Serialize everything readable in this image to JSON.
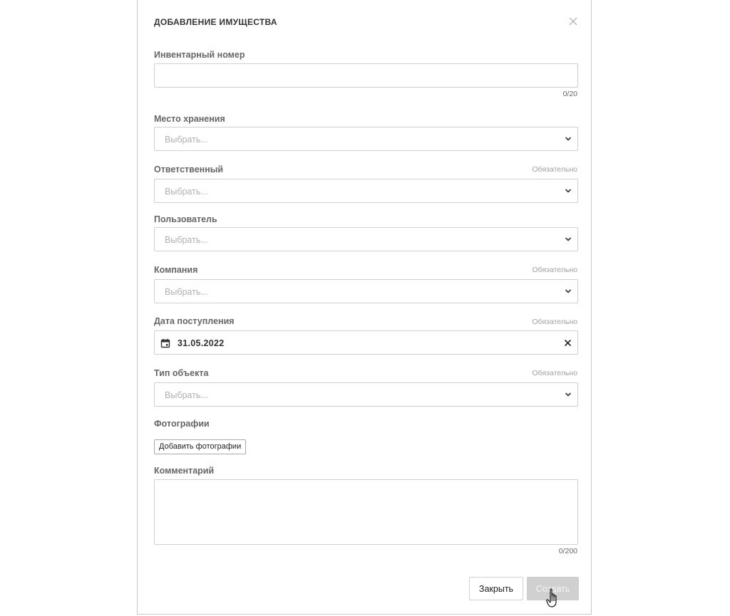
{
  "dialog": {
    "title": "ДОБАВЛЕНИЕ ИМУЩЕСТВА",
    "close_icon": "close-icon"
  },
  "required_text": "Обязательно",
  "fields": {
    "inventory_number": {
      "label": "Инвентарный номер",
      "value": "",
      "counter": "0/20"
    },
    "storage_location": {
      "label": "Место хранения",
      "placeholder": "Выбрать..."
    },
    "responsible": {
      "label": "Ответственный",
      "placeholder": "Выбрать...",
      "required": true
    },
    "user": {
      "label": "Пользователь",
      "placeholder": "Выбрать..."
    },
    "company": {
      "label": "Компания",
      "placeholder": "Выбрать...",
      "required": true
    },
    "receipt_date": {
      "label": "Дата поступления",
      "value": "31.05.2022",
      "required": true
    },
    "object_type": {
      "label": "Тип объекта",
      "placeholder": "Выбрать...",
      "required": true
    },
    "photos": {
      "label": "Фотографии",
      "button_label": "Добавить фотографии"
    },
    "comment": {
      "label": "Комментарий",
      "value": "",
      "counter": "0/200"
    }
  },
  "footer": {
    "close_label": "Закрыть",
    "create_label": "Создать",
    "create_disabled": true
  },
  "colors": {
    "border": "#cfcfcf",
    "label": "#666666",
    "placeholder": "#b0b0b0",
    "disabled_button": "#d0d0d0"
  }
}
